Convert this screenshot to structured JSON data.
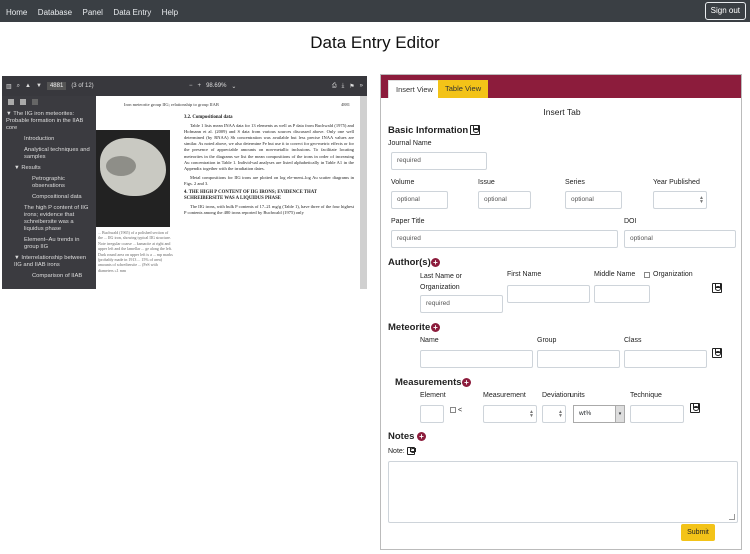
{
  "nav": {
    "items": [
      "Home",
      "Database",
      "Panel",
      "Data Entry",
      "Help"
    ],
    "signout": "Sign out"
  },
  "page_title": "Data Entry Editor",
  "pdf": {
    "page_num": "4881",
    "page_of": "(3 of 12)",
    "zoom": "98.69%",
    "outline": [
      {
        "label": "The IIG iron meteorites: Probable formation in the IIAB core",
        "level": 0
      },
      {
        "label": "Introduction",
        "level": 1
      },
      {
        "label": "Analytical techniques and samples",
        "level": 1
      },
      {
        "label": "Results",
        "level": 0
      },
      {
        "label": "Petrographic observations",
        "level": 2
      },
      {
        "label": "Compositional data",
        "level": 2
      },
      {
        "label": "The high P content of IIG irons; evidence that schreibersite was a liquidus phase",
        "level": 1
      },
      {
        "label": "Element–Au trends in group IIG",
        "level": 1
      },
      {
        "label": "Interrelationship between IIG and IIAB irons",
        "level": 0
      },
      {
        "label": "Comparison of IIAB",
        "level": 2
      }
    ],
    "running_head": "Iron meteorite group IIG; relationship to group IIAB",
    "running_page": "4881",
    "section_heading": "3.2. Compositional data",
    "para1": "Table 1 lists mean INAA data for 13 elements as well as P data from Buchwald (1975) and Hofmann et al. (2009) and S data from various sources discussed above. Only one well determined (by RNAA) Sb concentration was available but less precise INAA values are similar. As noted above, we also determine Fe but use it to correct for geo-metric effects or for the presence of appreciable amounts on non-metallic inclusions. To facilitate locating meteorites in the diagrams we list the mean compositions of the irons in order of increasing Au concentration in Table 1. Individ-ual analyses are listed alphabetically in Table A1 in the Appendix together with the irradiation dates.",
    "para2": "Metal compositions for IIG irons are plotted on log ele-ment–log Au scatter diagrams in Figs. 2 and 3.",
    "section_heading2": "4. THE HIGH P CONTENT OF IIG IRONS; EVIDENCE THAT SCHREIBERSITE WAS A LIQUIDUS PHASE",
    "para3": "The IIG irons, with bulk P contents of 17–21 mg/g (Table 1), have three of the four highest P contents among the 480 irons reported by Buchwald (1975) only",
    "left_caption": "... Buchwald (1965) of a polished section of the ... IIG iron, showing typical IIG structure. Note irregular coarse ... kamacite at right and upper left and the lamellar ... ge along the left. Dark round area on upper left is a ... mp marks (probably made in 1913 ... 15% of area) amounts of schreibersite ... (FeS with diameters ≤1 mm"
  },
  "form": {
    "tabs": {
      "insert": "Insert View",
      "table": "Table View"
    },
    "heading": "Insert Tab",
    "basic": {
      "title": "Basic Information",
      "journal_label": "Journal Name",
      "journal_value": "required",
      "volume_label": "Volume",
      "volume_value": "optional",
      "issue_label": "Issue",
      "issue_value": "optional",
      "series_label": "Series",
      "series_value": "optional",
      "year_label": "Year Published",
      "paper_label": "Paper Title",
      "paper_value": "required",
      "doi_label": "DOI",
      "doi_value": "optional"
    },
    "authors": {
      "title": "Author(s)",
      "last_label": "Last Name or Organization",
      "last_value": "required",
      "first_label": "First Name",
      "middle_label": "Middle Name",
      "org_label": "Organization"
    },
    "meteorite": {
      "title": "Meteorite",
      "name_label": "Name",
      "group_label": "Group",
      "class_label": "Class"
    },
    "measurements": {
      "title": "Measurements",
      "element_label": "Element",
      "lt_label": "<",
      "measurement_label": "Measurement",
      "deviation_label": "Deviation",
      "units_label": "units",
      "units_value": "wt%",
      "technique_label": "Technique"
    },
    "notes": {
      "title": "Notes",
      "note_label": "Note:"
    },
    "submit": "Submit"
  }
}
